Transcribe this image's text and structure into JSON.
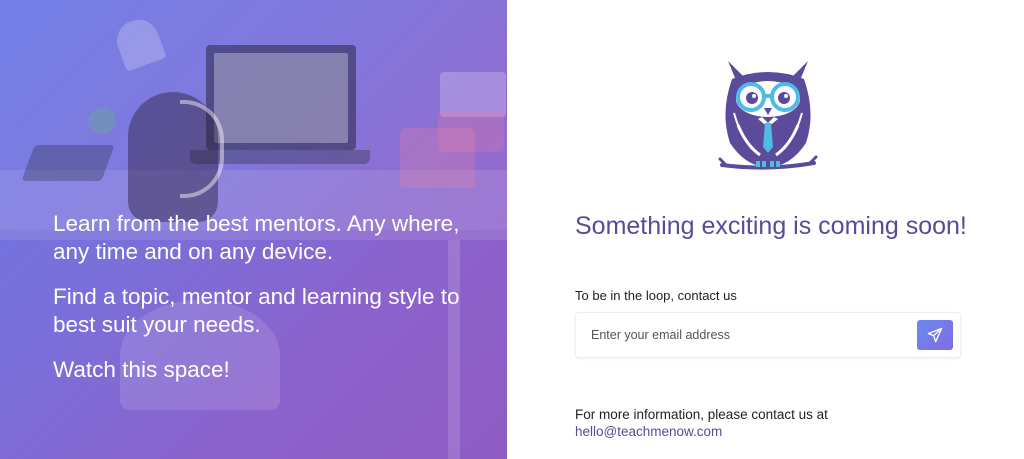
{
  "hero": {
    "line1": "Learn from the best mentors. Any where, any time and on any device.",
    "line2": "Find a topic, mentor and learning style to best suit your needs.",
    "line3": "Watch this space!"
  },
  "logo": {
    "icon": "owl-logo-icon"
  },
  "main": {
    "headline": "Something exciting is coming soon!",
    "subscribe_label": "To be in the loop, contact us",
    "email_placeholder": "Enter your email address",
    "send_icon": "paper-plane-icon",
    "info_text": "For more information, please contact us at",
    "contact_email": "hello@teachmenow.com"
  },
  "colors": {
    "accent": "#5a4a97",
    "owl_purple": "#5b4b9a",
    "owl_blue": "#4dbbe4",
    "button_gradient_start": "#6b8af0",
    "button_gradient_end": "#7f6be0"
  }
}
